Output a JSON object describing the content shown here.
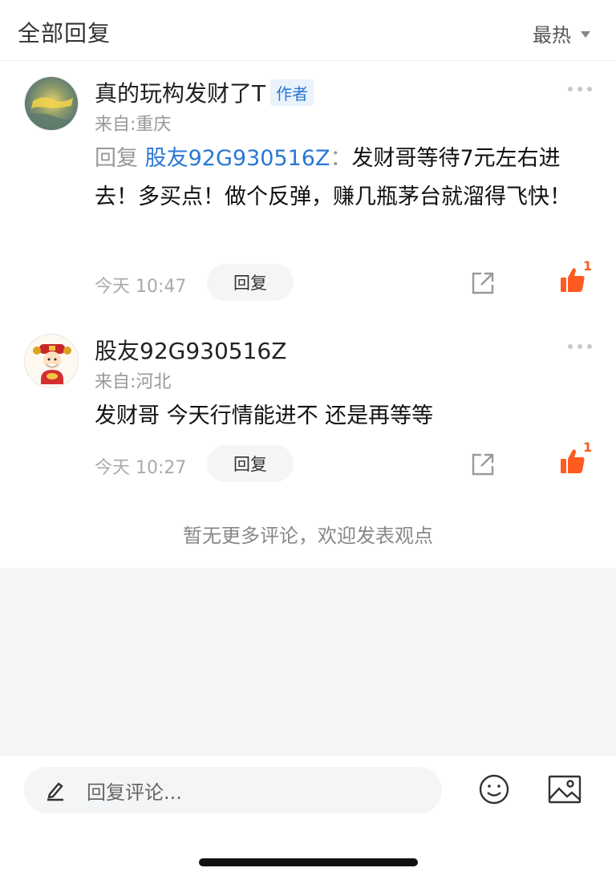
{
  "header": {
    "title": "全部回复",
    "sort_label": "最热"
  },
  "comments": [
    {
      "username": "真的玩构发财了T",
      "badge": "作者",
      "location": "来自:重庆",
      "reply_prefix": "回复",
      "reply_target": "股友92G930516Z",
      "reply_colon": "：",
      "text": "发财哥等待7元左右进去！多买点！做个反弹，赚几瓶茅台就溜得飞快！",
      "time": "今天 10:47",
      "reply_button": "回复",
      "like_count": "1"
    },
    {
      "username": "股友92G930516Z",
      "location": "来自:河北",
      "text": "发财哥 今天行情能进不 还是再等等",
      "time": "今天 10:27",
      "reply_button": "回复",
      "like_count": "1"
    }
  ],
  "no_more": "暂无更多评论，欢迎发表观点",
  "bottom_bar": {
    "placeholder": "回复评论..."
  },
  "colors": {
    "accent_blue": "#2a77d4",
    "like_orange": "#ff5a1f"
  },
  "icons": [
    "chevron-down-icon",
    "more-dots-icon",
    "share-icon",
    "thumbs-up-icon",
    "pencil-icon",
    "emoji-icon",
    "image-icon"
  ]
}
